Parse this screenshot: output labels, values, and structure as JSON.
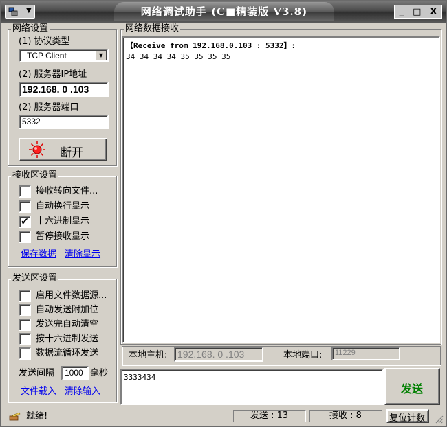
{
  "window": {
    "title": "网络调试助手 (C■精装版 V3.8)",
    "controls": {
      "minimize": "_",
      "maximize": "□",
      "close": "X"
    }
  },
  "net_settings": {
    "title": "网络设置",
    "protocol_label": "(1) 协议类型",
    "protocol_value": "TCP Client",
    "ip_label": "(2) 服务器IP地址",
    "ip_value": "192.168. 0 .103",
    "port_label": "(2) 服务器端口",
    "port_value": "5332",
    "connect_button": "断开",
    "connect_indicator_color": "#e00000"
  },
  "recv_settings": {
    "title": "接收区设置",
    "options": [
      {
        "label": "接收转向文件...",
        "checked": false
      },
      {
        "label": "自动换行显示",
        "checked": false
      },
      {
        "label": "十六进制显示",
        "checked": true
      },
      {
        "label": "暂停接收显示",
        "checked": false
      }
    ],
    "save_link": "保存数据",
    "clear_link": "清除显示"
  },
  "send_settings": {
    "title": "发送区设置",
    "options": [
      {
        "label": "启用文件数据源...",
        "checked": false
      },
      {
        "label": "自动发送附加位",
        "checked": false
      },
      {
        "label": "发送完自动清空",
        "checked": false
      },
      {
        "label": "按十六进制发送",
        "checked": false
      },
      {
        "label": "数据流循环发送",
        "checked": false
      }
    ],
    "interval_label": "发送间隔",
    "interval_value": "1000",
    "interval_unit": "毫秒",
    "load_file_link": "文件载入",
    "clear_input_link": "清除输入"
  },
  "receive": {
    "title": "网络数据接收",
    "header_line": "【Receive from 192.168.0.103 : 5332】:",
    "data_line": "34 34 34 34 35 35 35 35"
  },
  "local": {
    "host_label": "本地主机:",
    "host_value": "192.168. 0 .103",
    "port_label": "本地端口:",
    "port_value": "11229"
  },
  "send": {
    "input_value": "3333434",
    "send_button": "发送",
    "send_button_color": "#008000"
  },
  "status": {
    "ready": "就绪!",
    "sent_label": "发送 : 13",
    "recv_label": "接收 : 8",
    "reset_button": "复位计数"
  }
}
